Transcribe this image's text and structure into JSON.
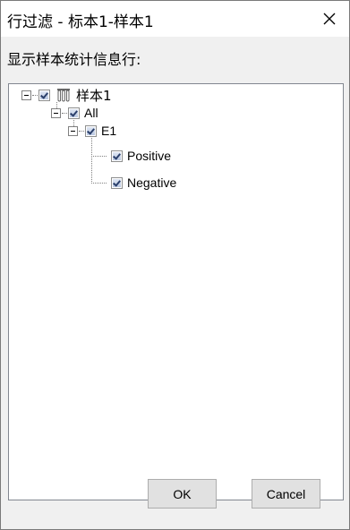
{
  "window": {
    "title": "行过滤 - 标本1-样本1",
    "close_icon": "close-icon"
  },
  "prompt": "显示样本统计信息行:",
  "tree": {
    "root": {
      "label": "样本1",
      "icon": "test-tube-rack-icon",
      "checked": true,
      "expanded": true
    },
    "children": [
      {
        "label": "All",
        "checked": true,
        "expanded": true,
        "children": [
          {
            "label": "E1",
            "checked": true,
            "expanded": true,
            "children": [
              {
                "label": "Positive",
                "checked": true
              },
              {
                "label": "Negative",
                "checked": true
              }
            ]
          }
        ]
      }
    ]
  },
  "buttons": {
    "ok": "OK",
    "cancel": "Cancel"
  },
  "colors": {
    "titlebar_bg": "#ffffff",
    "client_bg": "#f0f0f0",
    "button_bg": "#e1e1e1",
    "checkbox_check": "#2a3f6b"
  }
}
